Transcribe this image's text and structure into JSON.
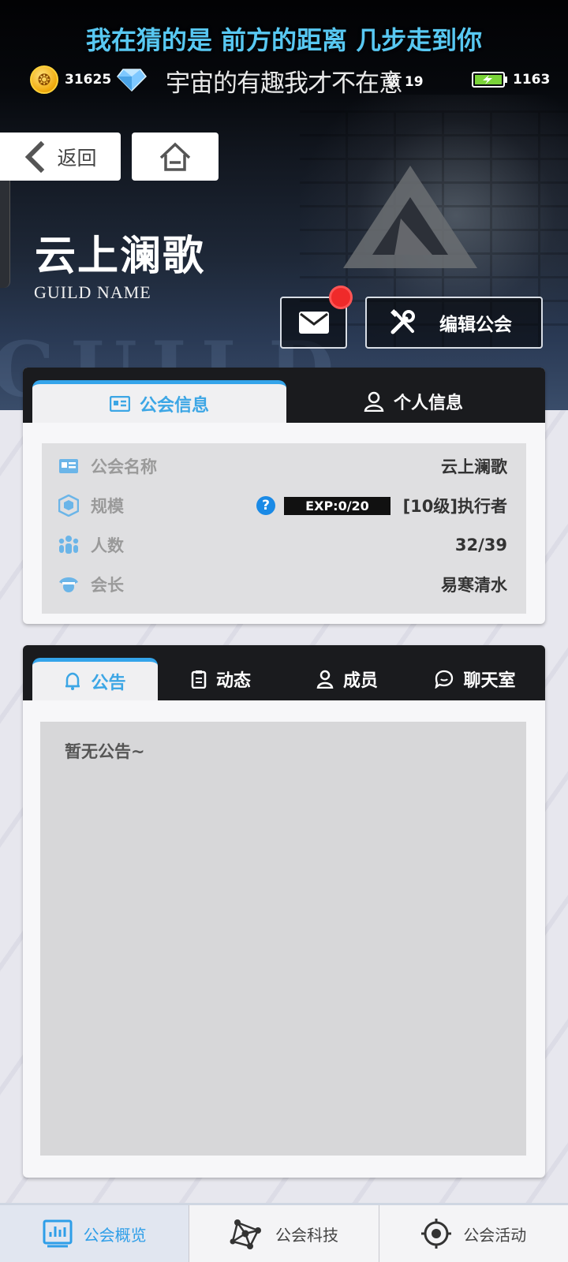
{
  "overlay": {
    "lyric_line1": "我在猜的是 前方的距离 几步走到你",
    "lyric_line2": "宇宙的有趣我才不在意"
  },
  "resources": {
    "coins": "31625",
    "level_text": "级 19",
    "stamina": "1163"
  },
  "nav": {
    "back_label": "返回"
  },
  "guild": {
    "title": "云上澜歌",
    "subtitle": "GUILD NAME",
    "edit_label": "编辑公会"
  },
  "info_card": {
    "tabs": [
      "公会信息",
      "个人信息"
    ],
    "rows": [
      {
        "label": "公会名称",
        "value": "云上澜歌"
      },
      {
        "label": "规模",
        "value": "[10级]执行者",
        "exp": "EXP:0/20",
        "help": "?"
      },
      {
        "label": "人数",
        "value": "32/39"
      },
      {
        "label": "会长",
        "value": "易寒清水"
      }
    ]
  },
  "board": {
    "tabs": [
      "公告",
      "动态",
      "成员",
      "聊天室"
    ],
    "notice_text": "暂无公告~"
  },
  "bottom_nav": {
    "items": [
      "公会概览",
      "公会科技",
      "公会活动"
    ]
  },
  "colors": {
    "accent": "#34a4ea",
    "lyric": "#58c8f2",
    "badge": "#ef2a2a"
  }
}
